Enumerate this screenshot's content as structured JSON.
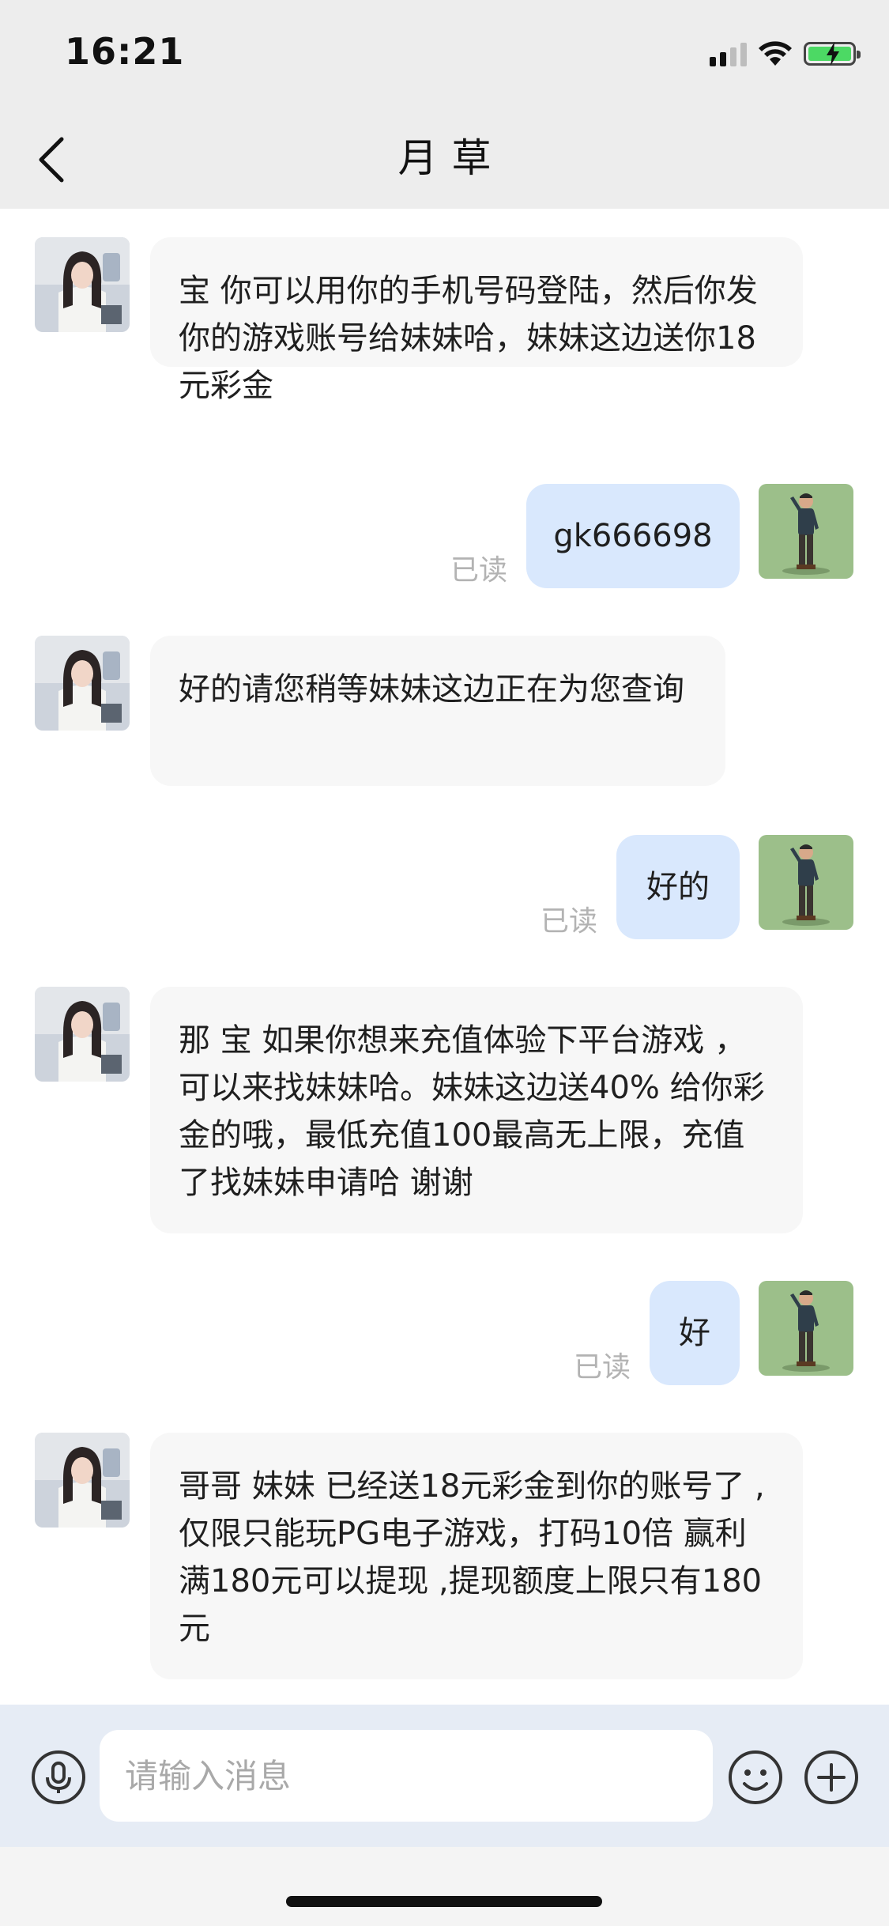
{
  "status_bar": {
    "time": "16:21"
  },
  "header": {
    "title": "月草"
  },
  "messages": [
    {
      "side": "in",
      "text": "宝 你可以用你的手机号码登陆，然后你发你的游戏账号给妹妹哈，妹妹这边送你18元彩金",
      "avatar": "female-avatar"
    },
    {
      "side": "out",
      "text": "gk666698",
      "read": "已读",
      "avatar": "male-avatar"
    },
    {
      "side": "in",
      "text": "好的请您稍等妹妹这边正在为您查询",
      "avatar": "female-avatar"
    },
    {
      "side": "out",
      "text": "好的",
      "read": "已读",
      "avatar": "male-avatar"
    },
    {
      "side": "in",
      "text": "那 宝 如果你想来充值体验下平台游戏 ，可以来找妹妹哈。妹妹这边送40% 给你彩金的哦，最低充值100最高无上限，充值了找妹妹申请哈 谢谢",
      "avatar": "female-avatar"
    },
    {
      "side": "out",
      "text": "好",
      "read": "已读",
      "avatar": "male-avatar"
    },
    {
      "side": "in",
      "text": "哥哥 妹妹 已经送18元彩金到你的账号了 ,仅限只能玩PG电子游戏，打码10倍 赢利满180元可以提现 ,提现额度上限只有180元",
      "avatar": "female-avatar"
    }
  ],
  "input": {
    "placeholder": "请输入消息",
    "value": ""
  },
  "colors": {
    "incoming_bubble": "#f7f7f7",
    "outgoing_bubble": "#d9e8fd",
    "header_bg": "#ededed",
    "input_bar_bg": "#e6ecf5"
  },
  "icons": [
    "back-arrow-icon",
    "voice-icon",
    "emoji-icon",
    "plus-icon",
    "wifi-icon",
    "battery-icon",
    "signal-icon"
  ]
}
